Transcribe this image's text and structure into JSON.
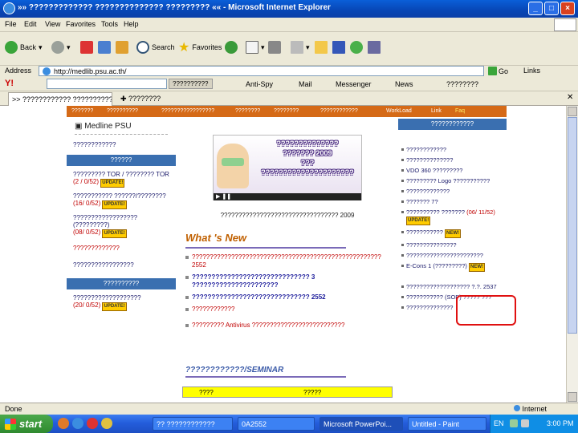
{
  "window": {
    "title": "»» ????????????? ?????????????? ????????? «« - Microsoft Internet Explorer"
  },
  "menu": [
    "File",
    "Edit",
    "View",
    "Favorites",
    "Tools",
    "Help"
  ],
  "toolbar": {
    "back": "Back",
    "search": "Search",
    "favorites": "Favorites"
  },
  "address": {
    "label": "Address",
    "url": "http://medlib.psu.ac.th/",
    "go": "Go",
    "links": "Links"
  },
  "ybar": {
    "search_btn": "??????????",
    "antispy": "Anti-Spy",
    "mail": "Mail",
    "messenger": "Messenger",
    "news": "News",
    "more": "????????"
  },
  "tab": {
    "label": ">> ???????????? ??????????",
    "new_tab": "????????"
  },
  "site_nav": [
    "???????",
    "??????????",
    "?????????????????",
    "????????",
    "????????",
    "????????????",
    "WorkLoad",
    "Link",
    "Faq"
  ],
  "left": {
    "medline": "Medline PSU",
    "medline_sub": "????????????",
    "news_header": "??????",
    "news": [
      {
        "text": "????????? TOR / ???????? TOR",
        "date": "(2 / 0/52)",
        "badge": "UPDATE!"
      },
      {
        "text": "??????????? ??????/????????",
        "date": "(16/ 0/52)",
        "badge": "UPDATE!"
      },
      {
        "text": "?????????????????? (?????????)",
        "date": "(08/ 0/52)",
        "badge": "UPDATE!"
      }
    ],
    "links": [
      "?????????????",
      "?????????????????"
    ],
    "jobs_header": "??????????",
    "job": {
      "text": "???????????????????",
      "date": "(20/ 0/52)",
      "badge": "UPDATE!"
    }
  },
  "banner": {
    "line1": "??????????????",
    "line2": "??????? 2009",
    "line3": "???",
    "line4": "?????????????????????",
    "caption": "????????????????????????????????? 2009"
  },
  "whats_new": {
    "title": "What 's New",
    "items": [
      "????????????????????????????????????????????????????? 2552",
      "?????????????????????????????? 3 ??????????????????????",
      "?????????????????????????????? 2552",
      "????????????",
      "????????? Antivirus ??????????????????????????"
    ]
  },
  "seminar": {
    "title": "????????????/SEMINAR",
    "col1": "????",
    "col2": "?????"
  },
  "right": {
    "header": "????????????",
    "items": [
      "????????????",
      "??????????????",
      "VDO 360 ?????????",
      "????????? Logo ???????????",
      "?????????????",
      "??????? 7?",
      "?????????? ???????",
      "???????????",
      "???????????????",
      "???????????????????????",
      "E-Cons  1 (?????????)",
      "??????????????????? ?.?. 2537",
      "??????????? (SOP) ????? ???",
      "??????????????"
    ],
    "badge_new": "NEW!",
    "update_date": "(06/ 11/52)"
  },
  "status": {
    "text": "Done",
    "zone": "Internet"
  },
  "taskbar": {
    "start": "start",
    "tasks": [
      "?? ????????????",
      "0A2552",
      "Microsoft PowerPoi...",
      "Untitled - Paint"
    ],
    "lang": "EN",
    "clock": "3:00 PM"
  },
  "colors": {
    "nav": "#d56a17",
    "box_header": "#3a6fb0",
    "highlight": "#e01010",
    "title_blue": "#0846b5"
  }
}
